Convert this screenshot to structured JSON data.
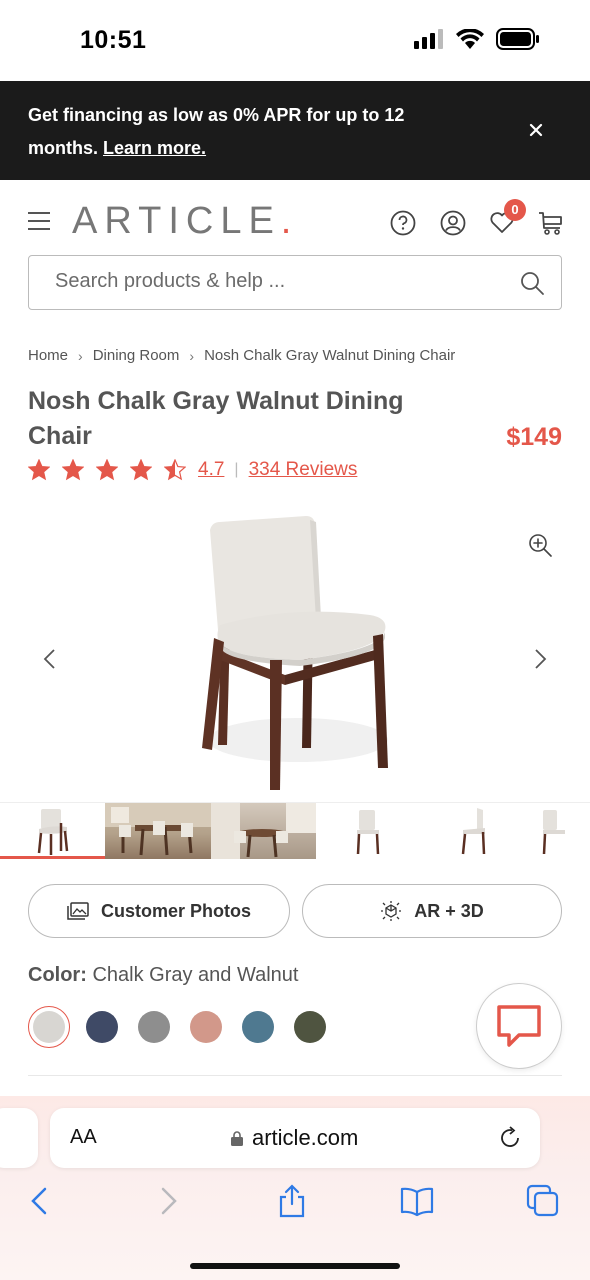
{
  "status": {
    "time": "10:51"
  },
  "promo": {
    "text": "Get financing as low as 0% APR for up to 12 months.",
    "link": "Learn more."
  },
  "header": {
    "logo": "ARTICLE",
    "logo_dot": ".",
    "cart_count": "0"
  },
  "search": {
    "placeholder": "Search products & help ..."
  },
  "breadcrumb": [
    "Home",
    "Dining Room",
    "Nosh Chalk Gray Walnut Dining Chair"
  ],
  "product": {
    "title": "Nosh Chalk Gray Walnut Dining Chair",
    "price": "$149",
    "rating": "4.7",
    "reviews": "334 Reviews",
    "rating_value": 4.5
  },
  "actions": {
    "customer_photos": "Customer Photos",
    "ar3d": "AR + 3D"
  },
  "color": {
    "label": "Color:",
    "value": "Chalk Gray and Walnut",
    "swatches": [
      "#d8d6d2",
      "#3f4a66",
      "#8e8e8e",
      "#d2988a",
      "#4f7990",
      "#4f5440"
    ]
  },
  "browser": {
    "aa": "AA",
    "url": "article.com"
  },
  "colors": {
    "accent": "#e4574a",
    "banner": "#1b1b1b"
  }
}
